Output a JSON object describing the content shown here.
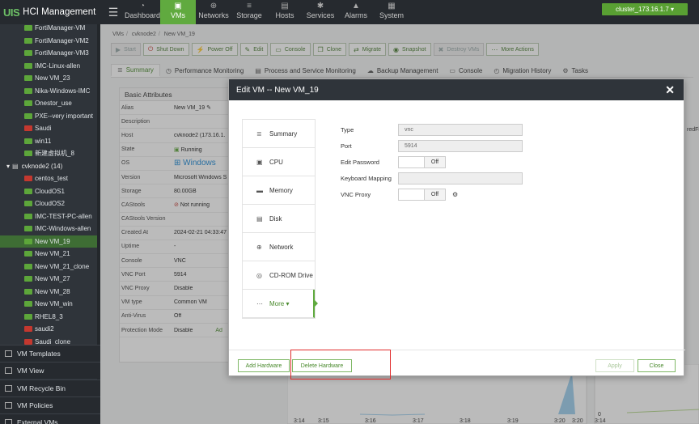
{
  "topbar": {
    "logo_mark": "UIS",
    "logo_text": "HCI Management",
    "nav": [
      {
        "label": "Dashboard",
        "icon": "dashboard-icon",
        "glyph": "◔"
      },
      {
        "label": "VMs",
        "icon": "vm-icon",
        "glyph": "▣",
        "active": true
      },
      {
        "label": "Networks",
        "icon": "network-icon",
        "glyph": "⊕"
      },
      {
        "label": "Storage",
        "icon": "storage-icon",
        "glyph": "≡"
      },
      {
        "label": "Hosts",
        "icon": "hosts-icon",
        "glyph": "▤"
      },
      {
        "label": "Services",
        "icon": "services-icon",
        "glyph": "✱"
      },
      {
        "label": "Alarms",
        "icon": "alarm-icon",
        "glyph": "▲"
      },
      {
        "label": "System",
        "icon": "system-icon",
        "glyph": "▦"
      }
    ],
    "cluster": "cluster_173.16.1.7 ▾"
  },
  "sidebar": {
    "items": [
      {
        "label": "FortiManager-VM",
        "status": "green",
        "level": 2
      },
      {
        "label": "FortiManager-VM2",
        "status": "green",
        "level": 2
      },
      {
        "label": "FortiManager-VM3",
        "status": "green",
        "level": 2
      },
      {
        "label": "IMC-Linux-allen",
        "status": "green",
        "level": 2
      },
      {
        "label": "New VM_23",
        "status": "green",
        "level": 2
      },
      {
        "label": "Nika-Windows-IMC",
        "status": "green",
        "level": 2
      },
      {
        "label": "Onestor_use",
        "status": "green",
        "level": 2
      },
      {
        "label": "PXE--very important",
        "status": "green",
        "level": 2
      },
      {
        "label": "Saudi",
        "status": "red",
        "level": 2
      },
      {
        "label": "win11",
        "status": "green",
        "level": 2
      },
      {
        "label": "新建虚拟机_8",
        "status": "green",
        "level": 2
      },
      {
        "label": "cvknode2 (14)",
        "status": "host",
        "level": 1
      },
      {
        "label": "centos_test",
        "status": "red",
        "level": 2
      },
      {
        "label": "CloudOS1",
        "status": "green",
        "level": 2
      },
      {
        "label": "CloudOS2",
        "status": "green",
        "level": 2
      },
      {
        "label": "IMC-TEST-PC-allen",
        "status": "green",
        "level": 2
      },
      {
        "label": "IMC-Windows-allen",
        "status": "green",
        "level": 2
      },
      {
        "label": "New VM_19",
        "status": "green",
        "level": 2,
        "selected": true
      },
      {
        "label": "New VM_21",
        "status": "green",
        "level": 2
      },
      {
        "label": "New VM_21_clone",
        "status": "green",
        "level": 2
      },
      {
        "label": "New VM_27",
        "status": "green",
        "level": 2
      },
      {
        "label": "New VM_28",
        "status": "green",
        "level": 2
      },
      {
        "label": "New VM_win",
        "status": "green",
        "level": 2
      },
      {
        "label": "RHEL8_3",
        "status": "green",
        "level": 2
      },
      {
        "label": "saudi2",
        "status": "red",
        "level": 2
      },
      {
        "label": "Saudi_clone",
        "status": "red",
        "level": 2
      }
    ],
    "bottom": [
      "VM Templates",
      "VM View",
      "VM Recycle Bin",
      "VM Policies",
      "External VMs"
    ]
  },
  "breadcrumb": [
    "VMs",
    "cvknode2",
    "New VM_19"
  ],
  "toolbar": [
    {
      "label": "Start",
      "icon": "start-icon",
      "glyph": "▶",
      "disabled": true
    },
    {
      "label": "Shut Down",
      "icon": "power-icon",
      "glyph": "⏻"
    },
    {
      "label": "Power Off",
      "icon": "plug-icon",
      "glyph": "⚡"
    },
    {
      "label": "Edit",
      "icon": "edit-icon",
      "glyph": "✎"
    },
    {
      "label": "Console",
      "icon": "console-icon",
      "glyph": "▭"
    },
    {
      "label": "Clone",
      "icon": "clone-icon",
      "glyph": "❐"
    },
    {
      "label": "Migrate",
      "icon": "migrate-icon",
      "glyph": "⇄"
    },
    {
      "label": "Snapshot",
      "icon": "camera-icon",
      "glyph": "◉"
    },
    {
      "label": "Destroy VMs",
      "icon": "destroy-icon",
      "glyph": "✖",
      "disabled": true
    },
    {
      "label": "More Actions",
      "icon": "more-icon",
      "glyph": "⋯"
    }
  ],
  "tabs": [
    {
      "label": "Summary",
      "icon": "summary-icon",
      "glyph": "≣",
      "active": true
    },
    {
      "label": "Performance Monitoring",
      "icon": "monitor-icon",
      "glyph": "◷"
    },
    {
      "label": "Process and Service Monitoring",
      "icon": "process-icon",
      "glyph": "▤"
    },
    {
      "label": "Backup Management",
      "icon": "backup-icon",
      "glyph": "☁"
    },
    {
      "label": "Console",
      "icon": "console-icon",
      "glyph": "▭"
    },
    {
      "label": "Migration History",
      "icon": "history-icon",
      "glyph": "◴"
    },
    {
      "label": "Tasks",
      "icon": "tasks-icon",
      "glyph": "⚙"
    }
  ],
  "basic_attributes": {
    "title": "Basic Attributes",
    "rows": [
      {
        "k": "Alias",
        "v": "New VM_19 ✎"
      },
      {
        "k": "Description",
        "v": ""
      },
      {
        "k": "Host",
        "v": "cvknode2 (173.16.1."
      },
      {
        "k": "State",
        "v": "Running",
        "icon": "running"
      },
      {
        "k": "OS",
        "v": "Windows",
        "icon": "windows"
      },
      {
        "k": "Version",
        "v": "Microsoft Windows S"
      },
      {
        "k": "Storage",
        "v": "80.00GB"
      },
      {
        "k": "CAStools",
        "v": "Not running",
        "icon": "notrunning"
      },
      {
        "k": "CAStools Version",
        "v": ""
      },
      {
        "k": "Created At",
        "v": "2024-02-21 04:33:47"
      },
      {
        "k": "Uptime",
        "v": "-"
      },
      {
        "k": "Console",
        "v": "VNC"
      },
      {
        "k": "VNC Port",
        "v": "5914"
      },
      {
        "k": "VNC Proxy",
        "v": "Disable"
      },
      {
        "k": "VM type",
        "v": "Common VM"
      },
      {
        "k": "Anti-Virus",
        "v": "Off"
      },
      {
        "k": "Protection Mode",
        "v": "Disable"
      }
    ],
    "protection_link": "Ad"
  },
  "background_chart": {
    "right_fragment": "redFil",
    "x_ticks": [
      "3:14",
      "3:15",
      "3:16",
      "3:17",
      "3:18",
      "3:19",
      "3:20",
      "3:20"
    ],
    "y_zero": "0",
    "right_x_ticks": [
      "3:14"
    ]
  },
  "dialog": {
    "title": "Edit VM -- New VM_19",
    "menu": [
      {
        "label": "Summary",
        "icon": "summary-icon",
        "glyph": "≣"
      },
      {
        "label": "CPU",
        "icon": "cpu-icon",
        "glyph": "▣"
      },
      {
        "label": "Memory",
        "icon": "memory-icon",
        "glyph": "▬"
      },
      {
        "label": "Disk",
        "icon": "disk-icon",
        "glyph": "▤"
      },
      {
        "label": "Network",
        "icon": "network-icon",
        "glyph": "⊕"
      },
      {
        "label": "CD-ROM Drive",
        "icon": "cdrom-icon",
        "glyph": "◎"
      },
      {
        "label": "More ▾",
        "icon": "more-icon",
        "glyph": "⋯",
        "active": true
      }
    ],
    "fields": {
      "type_label": "Type",
      "type_value": "vnc",
      "port_label": "Port",
      "port_value": "5914",
      "edit_password_label": "Edit Password",
      "edit_password_state": "Off",
      "keyboard_mapping_label": "Keyboard Mapping",
      "keyboard_mapping_value": "",
      "vnc_proxy_label": "VNC Proxy",
      "vnc_proxy_state": "Off"
    },
    "buttons": {
      "add_hardware": "Add Hardware",
      "delete_hardware": "Delete Hardware",
      "apply": "Apply",
      "close": "Close"
    }
  }
}
